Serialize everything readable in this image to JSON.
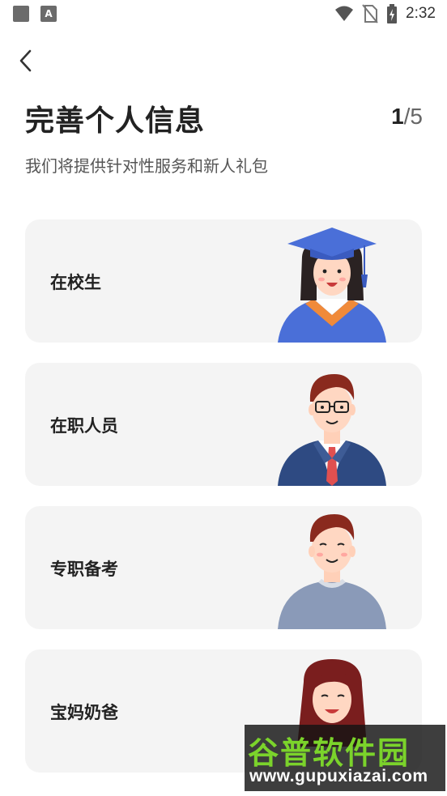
{
  "status_bar": {
    "time": "2:32",
    "left_icons": [
      "notification-square-icon",
      "text-a-icon"
    ],
    "right_icons": [
      "wifi-icon",
      "no-sim-icon",
      "battery-charging-icon"
    ]
  },
  "header": {
    "back_icon": "chevron-left-icon",
    "title": "完善个人信息",
    "progress_current": "1",
    "progress_total": "/5",
    "subtitle": "我们将提供针对性服务和新人礼包"
  },
  "options": [
    {
      "label": "在校生",
      "figure": "graduate-figure"
    },
    {
      "label": "在职人员",
      "figure": "office-worker-figure"
    },
    {
      "label": "专职备考",
      "figure": "student-man-figure"
    },
    {
      "label": "宝妈奶爸",
      "figure": "parent-figure"
    }
  ],
  "watermark": {
    "top": "谷普软件园",
    "bottom": "www.gupuxiazai.com"
  },
  "colors": {
    "card_bg": "#f4f4f4",
    "text_dark": "#222222",
    "text_sub": "#555555",
    "watermark_green": "#7bd32b"
  }
}
